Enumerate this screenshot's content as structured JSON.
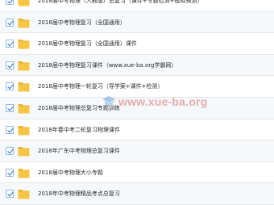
{
  "files": [
    "2018届中考物理（人教版）总复习（课件+专题检测+模拟预测）",
    "2018届中考物理复习（全国通用）",
    "2018届中考物理复习（全国通用）课件",
    "2018届中考物理复习课件（www.xue-ba.org学霸网）",
    "2018届中考物理一轮复习（导学案+课件+检测）",
    "2018届中考物理总复习专题训练",
    "2018年春中考二轮复习物理课件",
    "2018年广东中考物理总复习课件",
    "2018届中考物理大小专题",
    "2018年中考物理精品考点总复习"
  ],
  "watermark": {
    "text": "www.xue-ba.org"
  },
  "colors": {
    "folder": "#f6c544",
    "folder_dark": "#e9b233",
    "check": "#1e6fd0",
    "watermark": "#d76e6e"
  }
}
